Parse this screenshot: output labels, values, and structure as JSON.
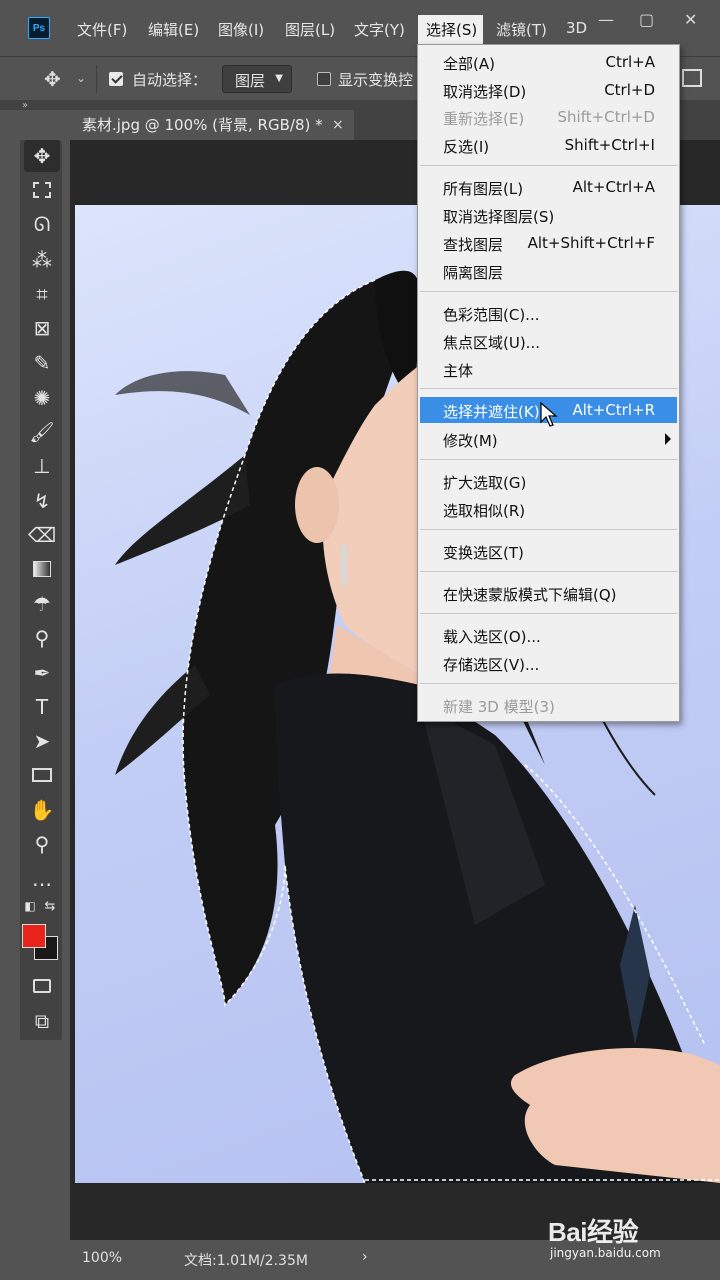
{
  "app": {
    "logo_text": "Ps"
  },
  "menubar": {
    "items": [
      "文件(F)",
      "编辑(E)",
      "图像(I)",
      "图层(L)",
      "文字(Y)",
      "选择(S)",
      "滤镜(T)",
      "3D"
    ],
    "active_index": 5
  },
  "window_controls": {
    "minimize": "—",
    "maximize": "▢",
    "close": "✕"
  },
  "options_bar": {
    "auto_select_label": "自动选择：",
    "auto_select_checked": true,
    "auto_select_target": "图层",
    "show_transform_label": "显示变换控",
    "show_transform_checked": false
  },
  "document_tab": {
    "title": "素材.jpg @ 100% (背景, RGB/8) *",
    "close": "×"
  },
  "colors": {
    "foreground": "#e8231a",
    "background": "#1a1a1a",
    "menu_highlight": "#3a8ee6"
  },
  "select_menu": {
    "items": [
      {
        "label": "全部(A)",
        "shortcut": "Ctrl+A",
        "disabled": false
      },
      {
        "label": "取消选择(D)",
        "shortcut": "Ctrl+D",
        "disabled": false
      },
      {
        "label": "重新选择(E)",
        "shortcut": "Shift+Ctrl+D",
        "disabled": true
      },
      {
        "label": "反选(I)",
        "shortcut": "Shift+Ctrl+I",
        "disabled": false
      },
      {
        "label": "所有图层(L)",
        "shortcut": "Alt+Ctrl+A",
        "disabled": false
      },
      {
        "label": "取消选择图层(S)",
        "shortcut": "",
        "disabled": false
      },
      {
        "label": "查找图层",
        "shortcut": "Alt+Shift+Ctrl+F",
        "disabled": false
      },
      {
        "label": "隔离图层",
        "shortcut": "",
        "disabled": false
      },
      {
        "label": "色彩范围(C)...",
        "shortcut": "",
        "disabled": false
      },
      {
        "label": "焦点区域(U)...",
        "shortcut": "",
        "disabled": false
      },
      {
        "label": "主体",
        "shortcut": "",
        "disabled": false
      },
      {
        "label": "选择并遮住(K)...",
        "shortcut": "Alt+Ctrl+R",
        "disabled": false,
        "highlighted": true
      },
      {
        "label": "修改(M)",
        "shortcut": "",
        "disabled": false,
        "submenu": true
      },
      {
        "label": "扩大选取(G)",
        "shortcut": "",
        "disabled": false
      },
      {
        "label": "选取相似(R)",
        "shortcut": "",
        "disabled": false
      },
      {
        "label": "变换选区(T)",
        "shortcut": "",
        "disabled": false
      },
      {
        "label": "在快速蒙版模式下编辑(Q)",
        "shortcut": "",
        "disabled": false
      },
      {
        "label": "载入选区(O)...",
        "shortcut": "",
        "disabled": false
      },
      {
        "label": "存储选区(V)...",
        "shortcut": "",
        "disabled": false
      },
      {
        "label": "新建 3D 模型(3)",
        "shortcut": "",
        "disabled": true
      }
    ]
  },
  "status_bar": {
    "zoom": "100%",
    "doc_info": "文档:1.01M/2.35M",
    "arrow": "›"
  },
  "watermark": {
    "logo": "Bai经验",
    "url": "jingyan.baidu.com"
  }
}
